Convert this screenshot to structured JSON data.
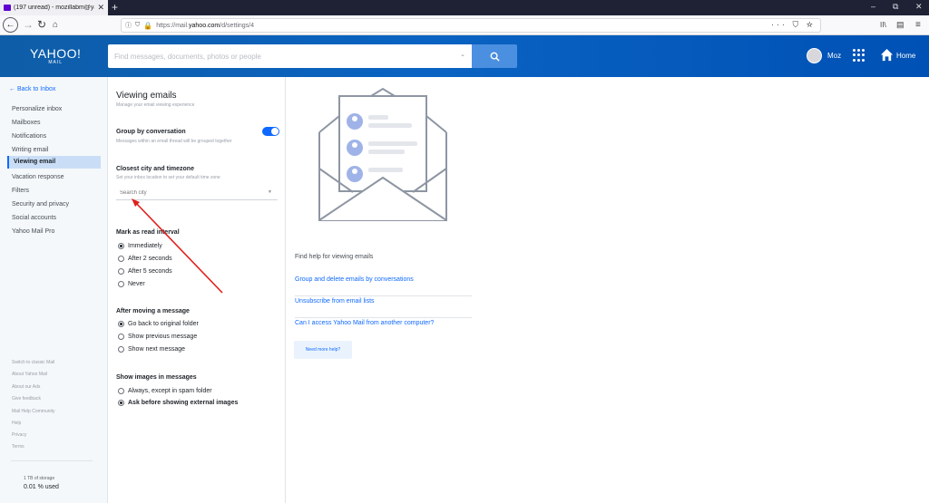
{
  "browser": {
    "tab_title": "(197 unread) - mozillabm@yah",
    "tab_close": "✕",
    "new_tab": "+",
    "url_prefix": "https://mail.",
    "url_domain": "yahoo.com",
    "url_path": "/d/settings/4",
    "url_right_icons": "··· ⛉ ☆",
    "window_controls": [
      "–",
      "⧉",
      "✕"
    ],
    "toolbar_right": [
      "II\\",
      "▤",
      "≡"
    ]
  },
  "header": {
    "logo_line1": "YAHOO!",
    "logo_line2": "MAIL",
    "search_placeholder": "Find messages, documents, photos or people",
    "user_name": "Moz",
    "home_label": "Home",
    "brand_color": "#0a63c2"
  },
  "leftnav": {
    "back_label": "Back to Inbox",
    "items": [
      {
        "label": "Personalize inbox"
      },
      {
        "label": "Mailboxes"
      },
      {
        "label": "Notifications"
      },
      {
        "label": "Writing email"
      },
      {
        "label": "Viewing email",
        "active": true
      },
      {
        "label": "Vacation response"
      },
      {
        "label": "Filters"
      },
      {
        "label": "Security and privacy"
      },
      {
        "label": "Social accounts"
      },
      {
        "label": "Yahoo Mail Pro"
      }
    ],
    "footer_links": [
      "Switch to classic Mail",
      "About Yahoo Mail",
      "About our Ads",
      "Give feedback",
      "Mail Help Community",
      "Help",
      "Privacy",
      "Terms"
    ],
    "storage_total": "1 TB of storage",
    "storage_used": "0.01 % used"
  },
  "settings": {
    "title": "Viewing emails",
    "subtitle": "Manage your email viewing experience",
    "group_by": {
      "heading": "Group by conversation",
      "description": "Messages within an email thread will be grouped together",
      "enabled": true
    },
    "city": {
      "heading": "Closest city and timezone",
      "description": "Set your inbox location to set your default time zone",
      "placeholder": "Search city"
    },
    "mark_read": {
      "heading": "Mark as read interval",
      "options": [
        "Immediately",
        "After 2 seconds",
        "After 5 seconds",
        "Never"
      ],
      "selected": 0
    },
    "after_move": {
      "heading": "After moving a message",
      "options": [
        "Go back to original folder",
        "Show previous message",
        "Show next message"
      ],
      "selected": 0
    },
    "images": {
      "heading": "Show images in messages",
      "options": [
        "Always, except in spam folder",
        "Ask before showing external images"
      ],
      "selected": 1
    }
  },
  "help": {
    "title": "Find help for viewing emails",
    "links": [
      "Group and delete emails by conversations",
      "Unsubscribe from email lists",
      "Can I access Yahoo Mail from another computer?"
    ],
    "more_button": "Need more help?"
  },
  "annotation": {
    "arrow_color": "#e0201b"
  }
}
